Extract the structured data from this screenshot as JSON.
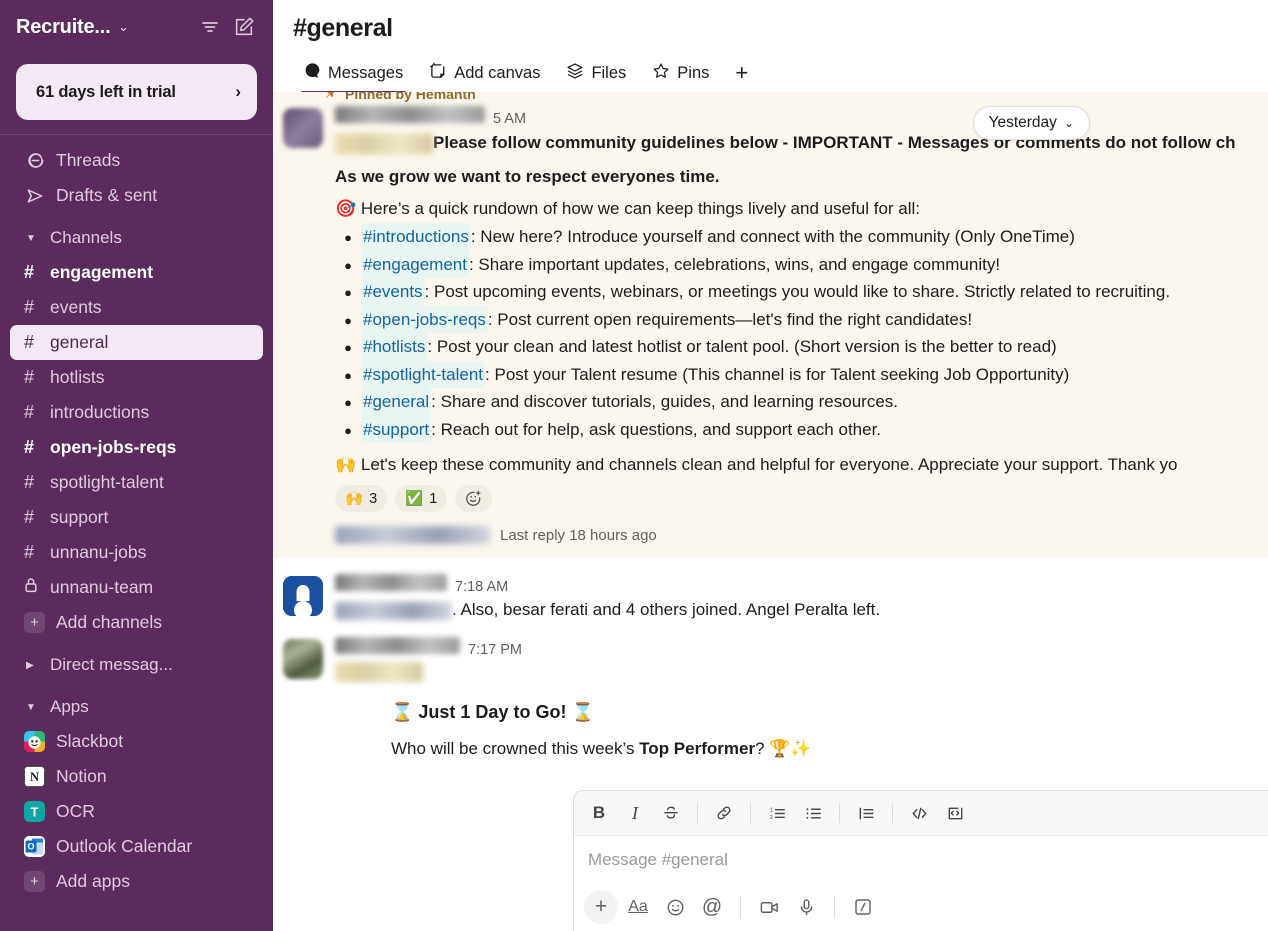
{
  "sidebar": {
    "workspace_name": "Recruite...",
    "workspace_caret": "⌄",
    "trial": {
      "label": "61 days left in trial",
      "chevron": "›"
    },
    "nav": [
      {
        "label": "Threads",
        "icon": "threads-icon"
      },
      {
        "label": "Drafts & sent",
        "icon": "drafts-icon"
      }
    ],
    "channels_section": {
      "label": "Channels",
      "triangle": "▼"
    },
    "channels": [
      {
        "label": "engagement",
        "prefix": "#",
        "bold": true,
        "active": false
      },
      {
        "label": "events",
        "prefix": "#",
        "bold": false,
        "active": false
      },
      {
        "label": "general",
        "prefix": "#",
        "bold": false,
        "active": true
      },
      {
        "label": "hotlists",
        "prefix": "#",
        "bold": false,
        "active": false
      },
      {
        "label": "introductions",
        "prefix": "#",
        "bold": false,
        "active": false
      },
      {
        "label": "open-jobs-reqs",
        "prefix": "#",
        "bold": true,
        "active": false
      },
      {
        "label": "spotlight-talent",
        "prefix": "#",
        "bold": false,
        "active": false
      },
      {
        "label": "support",
        "prefix": "#",
        "bold": false,
        "active": false
      },
      {
        "label": "unnanu-jobs",
        "prefix": "#",
        "bold": false,
        "active": false
      },
      {
        "label": "unnanu-team",
        "prefix": "lock",
        "bold": false,
        "active": false
      }
    ],
    "add_channels": {
      "label": "Add channels",
      "icon": "plus-icon"
    },
    "dm_section": {
      "label": "Direct messag...",
      "triangle": "▶"
    },
    "apps_section": {
      "label": "Apps",
      "triangle": "▼"
    },
    "apps": [
      {
        "label": "Slackbot",
        "icon": "slackbot-icon"
      },
      {
        "label": "Notion",
        "icon": "notion-icon"
      },
      {
        "label": "OCR",
        "icon": "ocr-icon"
      },
      {
        "label": "Outlook Calendar",
        "icon": "outlook-calendar-icon"
      }
    ],
    "add_apps": {
      "label": "Add apps",
      "icon": "plus-icon"
    }
  },
  "header": {
    "channel_hash": "#",
    "channel_name": "general",
    "tabs": [
      {
        "label": "Messages",
        "icon": "messages-icon",
        "active": true
      },
      {
        "label": "Add canvas",
        "icon": "add-canvas-icon",
        "active": false
      },
      {
        "label": "Files",
        "icon": "files-icon",
        "active": false
      },
      {
        "label": "Pins",
        "icon": "pins-icon",
        "active": false
      }
    ],
    "add_tab": "+"
  },
  "day_pill": {
    "label": "Yesterday",
    "caret": "⌄"
  },
  "pinned_message": {
    "pinned_by": "Pinned by Hemanth",
    "timestamp_partial": "5 AM",
    "title_line": "Please follow community guidelines below - IMPORTANT - Messages or comments do not follow ch",
    "subtitle": "As we grow we want to respect everyones time.",
    "intro_emoji": "🎯",
    "intro": "Here’s a quick rundown of how we can keep things lively and useful for all:",
    "bullets": [
      {
        "channel": "#introductions",
        "text": ": New here? Introduce yourself and connect with the community (Only OneTime)"
      },
      {
        "channel": "#engagement",
        "text": ": Share important updates, celebrations, wins, and engage community!"
      },
      {
        "channel": "#events",
        "text": ": Post upcoming events, webinars, or meetings you would like to share. Strictly related to recruiting."
      },
      {
        "channel": "#open-jobs-reqs",
        "text": ": Post current open requirements—let's find the right candidates!"
      },
      {
        "channel": "#hotlists",
        "text": ": Post your clean and latest hotlist or talent pool. (Short version is the better to read)"
      },
      {
        "channel": "#spotlight-talent",
        "text": ": Post your Talent resume (This channel is for Talent seeking Job Opportunity)"
      },
      {
        "channel": "#general",
        "text": ": Share and discover tutorials, guides, and learning resources."
      },
      {
        "channel": "#support",
        "text": ": Reach out for help, ask questions, and support each other."
      }
    ],
    "closing_emoji": "🙌",
    "closing": "Let's keep these community and channels clean and helpful for everyone. Appreciate your support. Thank yo",
    "reactions": [
      {
        "emoji": "🙌",
        "count": "3"
      },
      {
        "emoji": "✅",
        "count": "1"
      }
    ],
    "add_reaction_icon": "add-reaction-icon",
    "thread_summary": "Last reply 18 hours ago"
  },
  "messages": [
    {
      "time": "7:18 AM",
      "text": ". Also, besar ferati and 4 others joined. Angel Peralta left."
    },
    {
      "time": "7:17 PM",
      "heading": "⌛ Just 1 Day to Go! ⌛",
      "line_pre": "Who will be crowned this week’s ",
      "line_bold": "Top Performer",
      "line_post": "? 🏆✨"
    }
  ],
  "composer": {
    "placeholder": "Message #general",
    "format_buttons": [
      {
        "name": "bold-icon",
        "glyph": "B"
      },
      {
        "name": "italic-icon",
        "glyph": "I"
      },
      {
        "name": "strikethrough-icon",
        "glyph": "S"
      },
      {
        "name": "link-icon",
        "glyph": "link"
      },
      {
        "name": "ordered-list-icon",
        "glyph": "ol"
      },
      {
        "name": "bulleted-list-icon",
        "glyph": "ul"
      },
      {
        "name": "blockquote-icon",
        "glyph": "quote"
      },
      {
        "name": "code-icon",
        "glyph": "</>"
      },
      {
        "name": "code-block-icon",
        "glyph": "codeblock"
      }
    ],
    "action_buttons": [
      {
        "name": "plus-icon",
        "glyph": "+"
      },
      {
        "name": "text-format-icon",
        "glyph": "Aa"
      },
      {
        "name": "emoji-icon",
        "glyph": "emoji"
      },
      {
        "name": "mention-icon",
        "glyph": "@"
      },
      {
        "name": "video-icon",
        "glyph": "video"
      },
      {
        "name": "microphone-icon",
        "glyph": "mic"
      },
      {
        "name": "slash-command-icon",
        "glyph": "slash"
      }
    ]
  },
  "colors": {
    "sidebar_bg": "#5B2C5B",
    "sidebar_active": "#F6E9F6",
    "pinned_bg": "#FCF7EE",
    "link": "#1264A3",
    "tab_underline": "#6A2C6A"
  }
}
